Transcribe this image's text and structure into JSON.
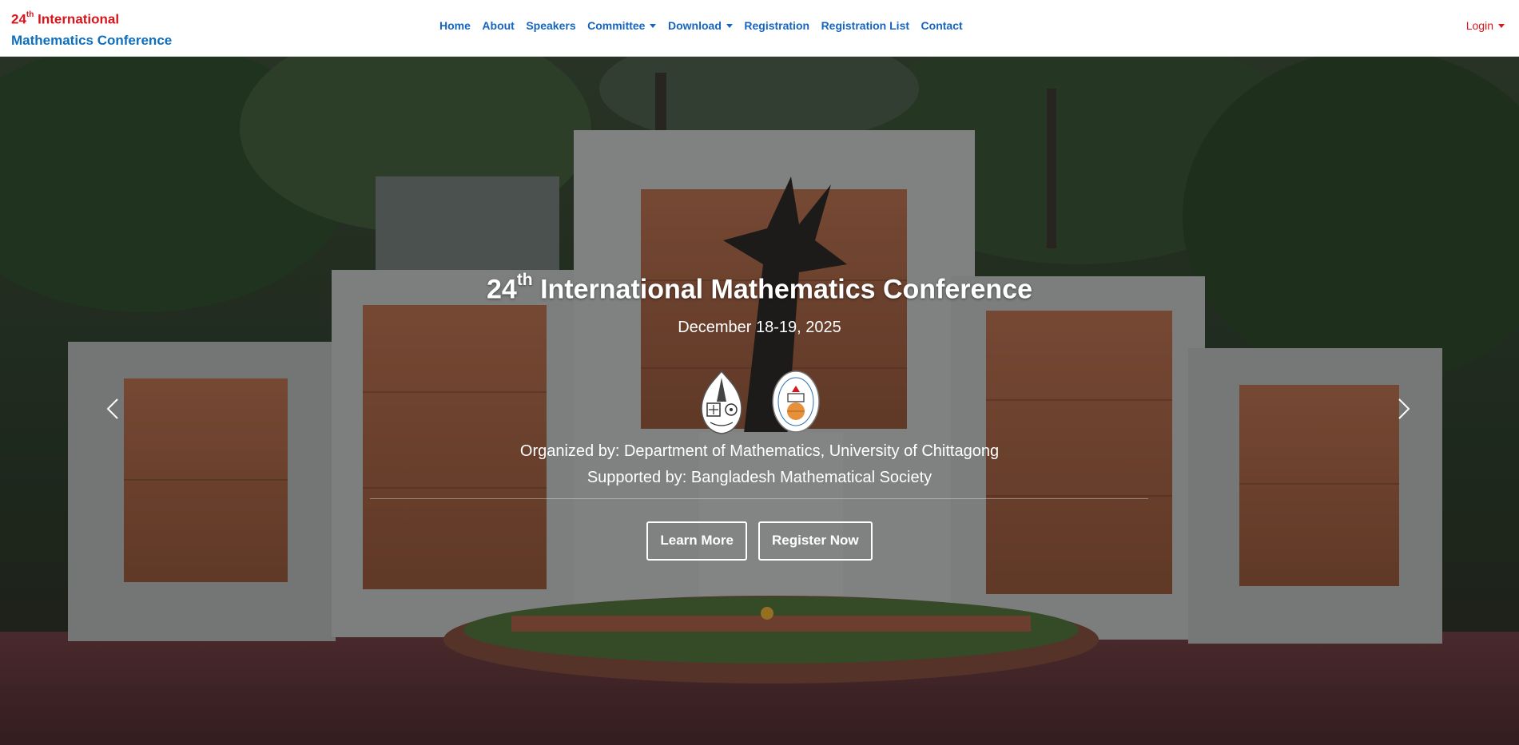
{
  "brand": {
    "line1_num": "24",
    "line1_sup": "th",
    "line1_rest": " International",
    "line2": "Mathematics Conference"
  },
  "nav": {
    "items": [
      {
        "label": "Home"
      },
      {
        "label": "About"
      },
      {
        "label": "Speakers"
      },
      {
        "label": "Committee"
      },
      {
        "label": "Download"
      },
      {
        "label": "Registration"
      },
      {
        "label": "Registration List"
      },
      {
        "label": "Contact"
      }
    ],
    "login": "Login"
  },
  "hero": {
    "title_num": "24",
    "title_sup": "th",
    "title_rest": " International Mathematics Conference",
    "date": "December 18-19, 2025",
    "organized": "Organized by: Department of Mathematics, University of Chittagong",
    "supported": "Supported by: Bangladesh Mathematical Society",
    "learn_more": "Learn More",
    "register_now": "Register Now"
  },
  "colors": {
    "brand_red": "#d9141b",
    "brand_blue": "#0f6fbf",
    "nav_blue": "#1565c0"
  },
  "icons": {
    "prev": "chevron-left-icon",
    "next": "chevron-right-icon",
    "dropdown": "caret-down-icon"
  }
}
